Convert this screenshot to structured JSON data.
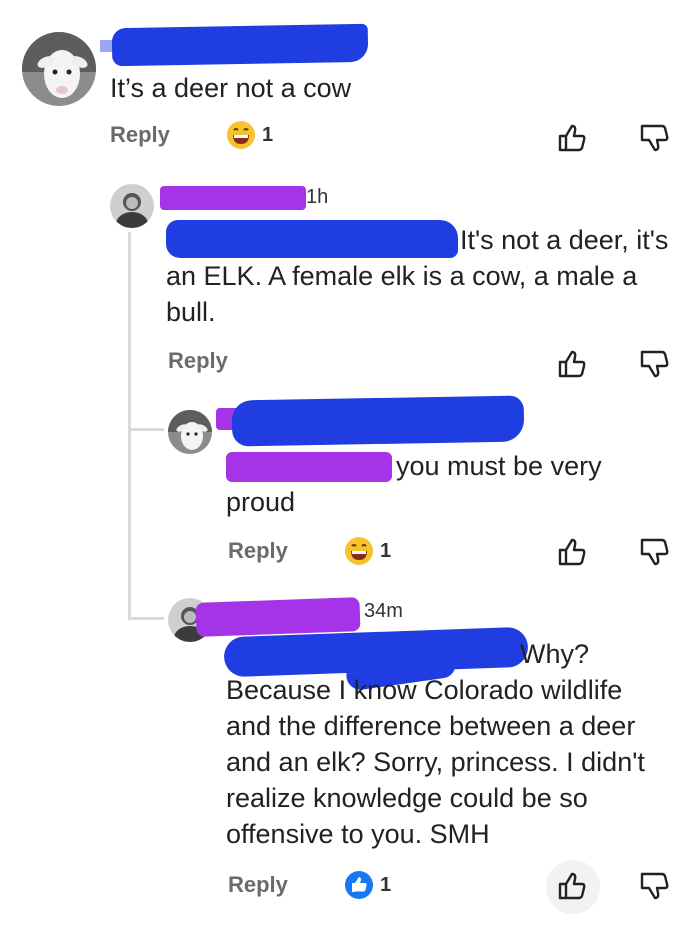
{
  "comments": [
    {
      "text": "It’s a deer not a cow",
      "reply_label": "Reply",
      "reaction": {
        "icon": "grinning-emoji-icon",
        "count": "1"
      }
    },
    {
      "time": "1h",
      "text_lines": [
        "It's not a deer, it's",
        "an ELK. A female elk is a cow, a male a",
        "bull."
      ],
      "reply_label": "Reply"
    },
    {
      "text_lines": [
        "you must be very",
        "proud"
      ],
      "reply_label": "Reply",
      "reaction": {
        "icon": "grinning-emoji-icon",
        "count": "1"
      }
    },
    {
      "time": "34m",
      "text_lines": [
        "Why?",
        "Because I know Colorado wildlife",
        "and the difference between a deer",
        "and an elk? Sorry, princess. I didn't",
        "realize knowledge could be so",
        "offensive to you. SMH"
      ],
      "reply_label": "Reply",
      "reaction": {
        "icon": "thumbs-up-reaction-icon",
        "count": "1"
      }
    }
  ],
  "colors": {
    "redaction_blue": "#1f3de0",
    "redaction_purple": "#a534e8",
    "reply_gray": "#6b6b6b",
    "like_blue": "#1877f2"
  }
}
